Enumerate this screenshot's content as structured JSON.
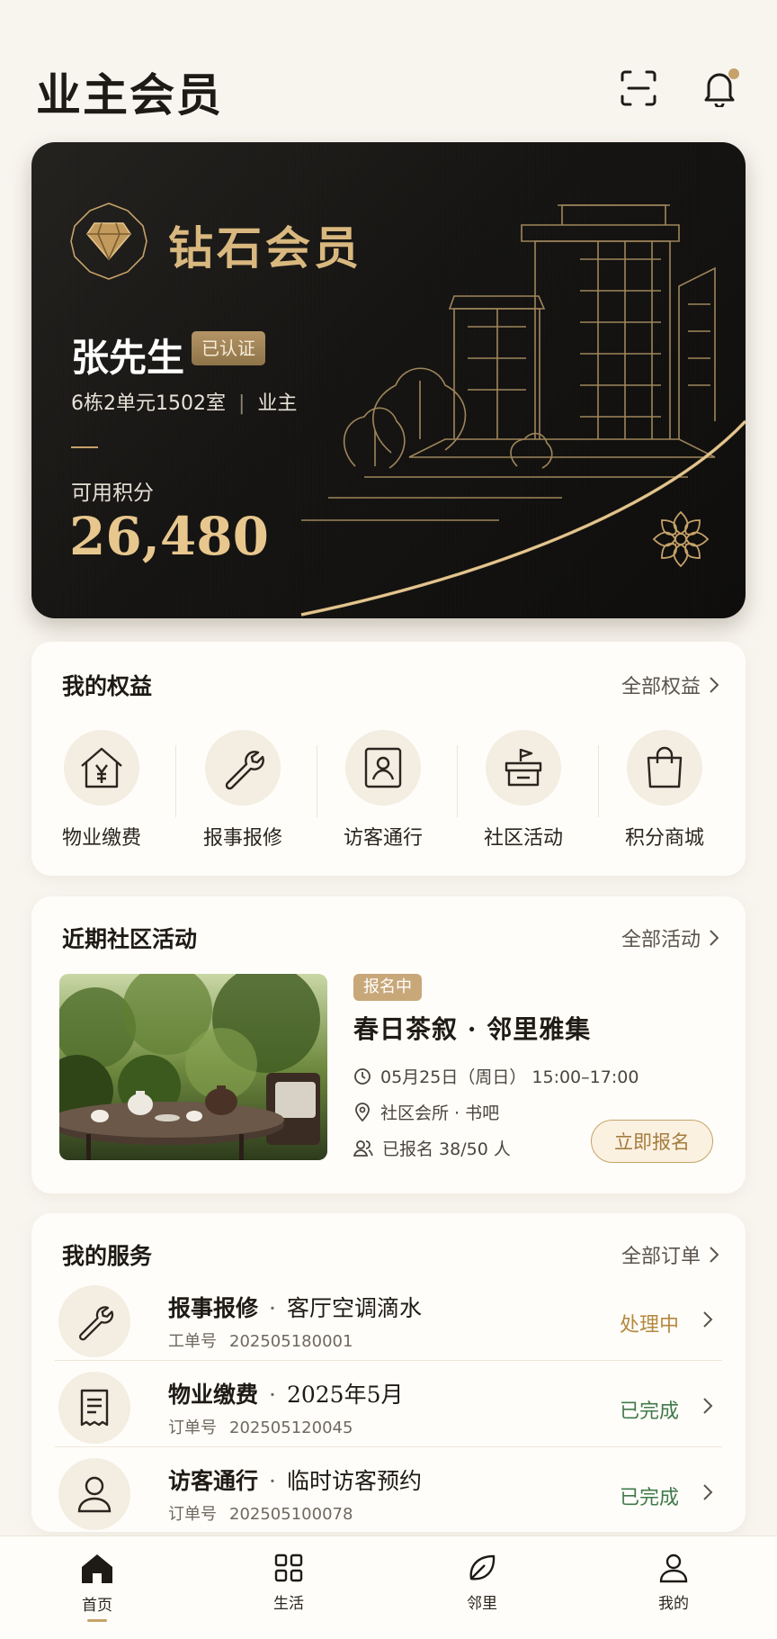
{
  "header": {
    "title": "业主会员",
    "scan_icon": "scan-icon",
    "bell_icon": "bell-icon"
  },
  "member_card": {
    "tier": "钻石会员",
    "name": "张先生",
    "verified": "已认证",
    "room": "6栋2单元1502室",
    "separator": "|",
    "role": "业主",
    "points_label": "可用积分",
    "points_value": "26,480"
  },
  "benefits": {
    "title": "我的权益",
    "more": "全部权益",
    "items": [
      {
        "label": "物业缴费",
        "icon": "house-yen-icon"
      },
      {
        "label": "报事报修",
        "icon": "wrench-icon"
      },
      {
        "label": "访客通行",
        "icon": "visitor-badge-icon"
      },
      {
        "label": "社区活动",
        "icon": "flag-icon"
      },
      {
        "label": "积分商城",
        "icon": "shopping-bag-icon"
      }
    ]
  },
  "activity": {
    "title": "近期社区活动",
    "more": "全部活动",
    "status": "报名中",
    "name": "春日茶叙 · 邻里雅集",
    "time": "05月25日（周日） 15:00–17:00",
    "location": "社区会所 · 书吧",
    "enrolled": "已报名 38/50 人",
    "signup": "立即报名"
  },
  "services": {
    "title": "我的服务",
    "more": "全部订单",
    "items": [
      {
        "name": "报事报修",
        "sep": "·",
        "detail": "客厅空调滴水",
        "no_label": "工单号",
        "no": "202505180001",
        "status": "处理中",
        "status_color": "#b3893f",
        "icon": "wrench-icon"
      },
      {
        "name": "物业缴费",
        "sep": "·",
        "detail": "2025年5月",
        "no_label": "订单号",
        "no": "202505120045",
        "status": "已完成",
        "status_color": "#3f7a4a",
        "icon": "receipt-icon"
      },
      {
        "name": "访客通行",
        "sep": "·",
        "detail": "临时访客预约",
        "no_label": "订单号",
        "no": "202505100078",
        "status": "已完成",
        "status_color": "#3f7a4a",
        "icon": "person-icon"
      }
    ]
  },
  "nav": {
    "items": [
      {
        "label": "首页",
        "icon": "home-icon",
        "active": true
      },
      {
        "label": "生活",
        "icon": "grid-icon",
        "active": false
      },
      {
        "label": "邻里",
        "icon": "leaf-icon",
        "active": false
      },
      {
        "label": "我的",
        "icon": "user-icon",
        "active": false
      }
    ]
  },
  "colors": {
    "gold": "#c6a269",
    "card_dark": "#151412",
    "background": "#f8f5ef",
    "processing": "#b3893f",
    "done": "#3f7a4a"
  }
}
